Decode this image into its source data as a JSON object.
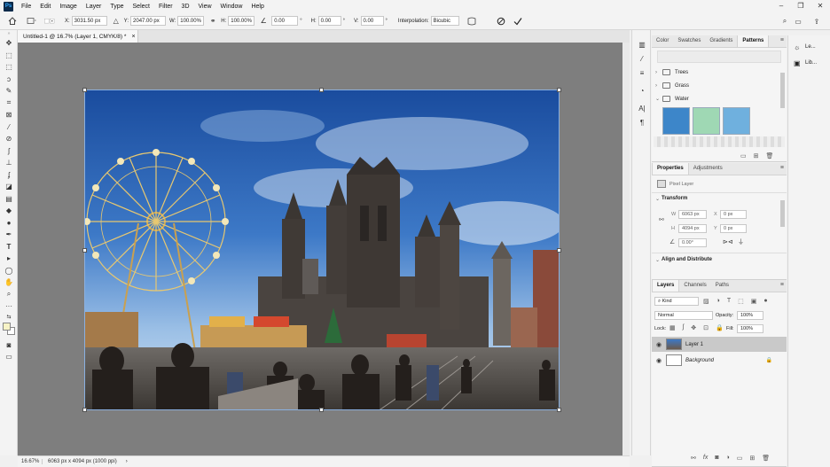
{
  "menubar": {
    "logo": "Ps",
    "items": [
      "File",
      "Edit",
      "Image",
      "Layer",
      "Type",
      "Select",
      "Filter",
      "3D",
      "View",
      "Window",
      "Help"
    ]
  },
  "window_controls": [
    "–",
    "❐",
    "✕"
  ],
  "options_bar": {
    "x_label": "X:",
    "x_value": "3031.50 px",
    "y_label": "Y:",
    "y_value": "2047.00 px",
    "w_label": "W:",
    "w_value": "100.00%",
    "h_label": "H:",
    "h_value": "100.00%",
    "angle_value": "0.00",
    "angle_unit": "°",
    "hskew_label": "H:",
    "hskew_value": "0.00",
    "vskew_label": "V:",
    "vskew_value": "0.00",
    "skew_unit": "°",
    "interp_label": "Interpolation:",
    "interp_value": "Bicubic"
  },
  "document": {
    "tab_title": "Untitled-1 @ 16.7% (Layer 1, CMYK/8) *",
    "close_glyph": "×"
  },
  "status": {
    "zoom": "16.67%",
    "info": "6063 px x 4094 px (1000 ppi)",
    "arrow": "›"
  },
  "color_panel": {
    "tabs": [
      "Color",
      "Swatches",
      "Gradients",
      "Patterns"
    ],
    "active_tab": "Patterns",
    "groups": [
      {
        "name": "Trees",
        "expanded": false
      },
      {
        "name": "Grass",
        "expanded": false
      },
      {
        "name": "Water",
        "expanded": true
      }
    ],
    "swatch_colors": [
      "#3d86c9",
      "#9fd8b4",
      "#6fb0de"
    ]
  },
  "properties_panel": {
    "tabs": [
      "Properties",
      "Adjustments"
    ],
    "active_tab": "Properties",
    "layer_type": "Pixel Layer",
    "transform_title": "Transform",
    "w_label": "W",
    "w_value": "6063 px",
    "h_label": "H",
    "h_value": "4094 px",
    "x_label": "X",
    "x_value": "0 px",
    "y_label": "Y",
    "y_value": "0 px",
    "angle_value": "0.00°",
    "align_title": "Align and Distribute"
  },
  "layers_panel": {
    "tabs": [
      "Layers",
      "Channels",
      "Paths"
    ],
    "active_tab": "Layers",
    "kind_label": "Kind",
    "blend_mode": "Normal",
    "opacity_label": "Opacity:",
    "opacity_value": "100%",
    "lock_label": "Lock:",
    "fill_label": "Fill:",
    "fill_value": "100%",
    "layers": [
      {
        "name": "Layer 1",
        "selected": true
      },
      {
        "name": "Background",
        "selected": false,
        "locked": true
      }
    ],
    "footer_icons": [
      "link-icon",
      "fx-icon",
      "mask-icon",
      "adjustment-icon",
      "group-icon",
      "new-layer-icon",
      "trash-icon"
    ]
  },
  "right_column": {
    "items": [
      {
        "icon": "lightbulb-icon",
        "label": "Le..."
      },
      {
        "icon": "library-icon",
        "label": "Lib..."
      }
    ]
  },
  "accent_color": "#31a8ff",
  "selection_color": "#c9c9c9"
}
